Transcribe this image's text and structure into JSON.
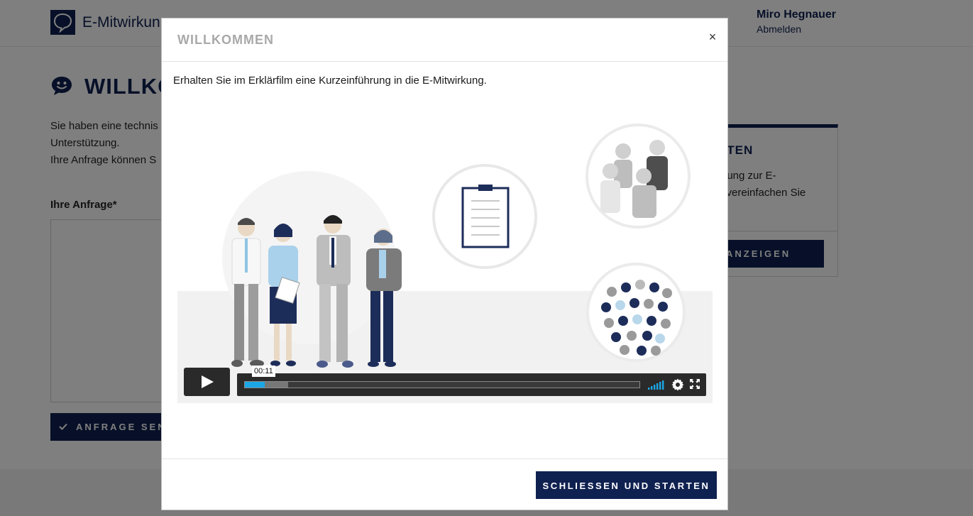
{
  "header": {
    "brand": "E-Mitwirkun",
    "user_name": "Miro Hegnauer",
    "logout_label": "Abmelden"
  },
  "page": {
    "title": "WILLKO",
    "intro_lines": [
      "Sie haben eine technis",
      "Unterstützung.",
      "Ihre Anfrage können S"
    ],
    "request_label": "Ihre Anfrage*",
    "send_button_label": "ANFRAGE SEN"
  },
  "side_card": {
    "title": "RTEN",
    "text_lines": [
      "hrung zur E-",
      "d vereinfachen Sie"
    ],
    "button_label": "ANZEIGEN"
  },
  "modal": {
    "title": "WILLKOMMEN",
    "close_label": "×",
    "text": "Erhalten Sie im Erklärfilm eine Kurzeinführung in die E-Mitwirkung.",
    "start_button_label": "SCHLIESSEN UND STARTEN"
  },
  "video": {
    "time_tooltip": "00:11",
    "played_fraction": 0.05,
    "buffered_fraction": 0.11
  },
  "colors": {
    "brand_navy": "#0f2150",
    "progress_blue": "#1ba7e6",
    "title_gray": "#a9a9a9"
  }
}
